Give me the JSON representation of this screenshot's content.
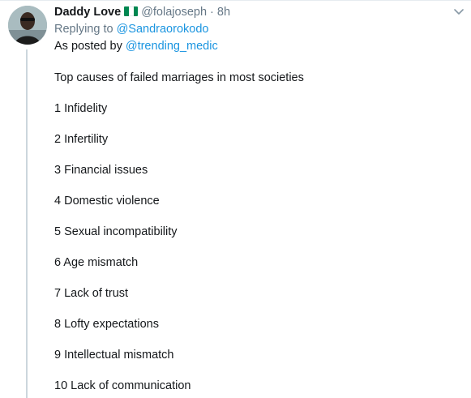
{
  "tweet": {
    "display_name": "Daddy Love",
    "flag_icon": "nigeria-flag-icon",
    "flag_colors": [
      "#008751",
      "#ffffff",
      "#008751"
    ],
    "handle": "@folajoseph",
    "separator": "·",
    "time": "8h",
    "replying_prefix": "Replying to",
    "replying_to": "@Sandraorokodo",
    "posted_prefix": "As posted by",
    "posted_by": "@trending_medic",
    "headline": "Top causes of failed marriages in most societies",
    "items": [
      "1 Infidelity",
      "2 Infertility",
      "3 Financial issues",
      "4 Domestic violence",
      "5 Sexual incompatibility",
      "6 Age mismatch",
      "7 Lack of trust",
      "8 Lofty expectations",
      "9 Intellectual mismatch",
      "10 Lack of communication"
    ]
  },
  "colors": {
    "link": "#1b95e0",
    "meta": "#657786",
    "text": "#14171a",
    "thread_line": "#ccd6dd"
  }
}
